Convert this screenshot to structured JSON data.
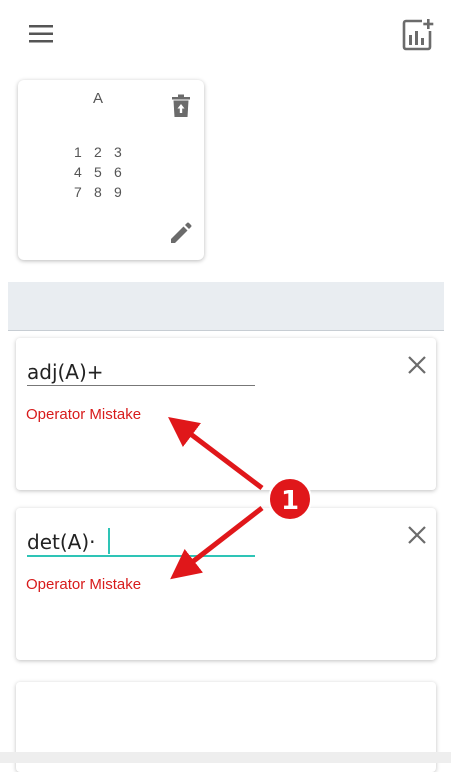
{
  "header": {
    "menu_icon": "hamburger-menu-icon",
    "add_chart_icon": "add-chart-icon"
  },
  "matrix_card": {
    "name": "A",
    "rows": [
      [
        "1",
        "2",
        "3"
      ],
      [
        "4",
        "5",
        "6"
      ],
      [
        "7",
        "8",
        "9"
      ]
    ],
    "delete_icon": "trash-icon",
    "edit_icon": "pencil-icon"
  },
  "expressions": [
    {
      "value": "adj(A)+",
      "error": "Operator Mistake",
      "focused": false
    },
    {
      "value": "det(A)·",
      "error": "Operator Mistake",
      "focused": true
    },
    {
      "value": "",
      "error": "",
      "focused": false
    }
  ],
  "annotation": {
    "badge_label": "1"
  },
  "colors": {
    "error": "#d81b1b",
    "accent": "#2ec4b6",
    "annotation": "#e0171a",
    "icon": "#6b6b6b"
  }
}
